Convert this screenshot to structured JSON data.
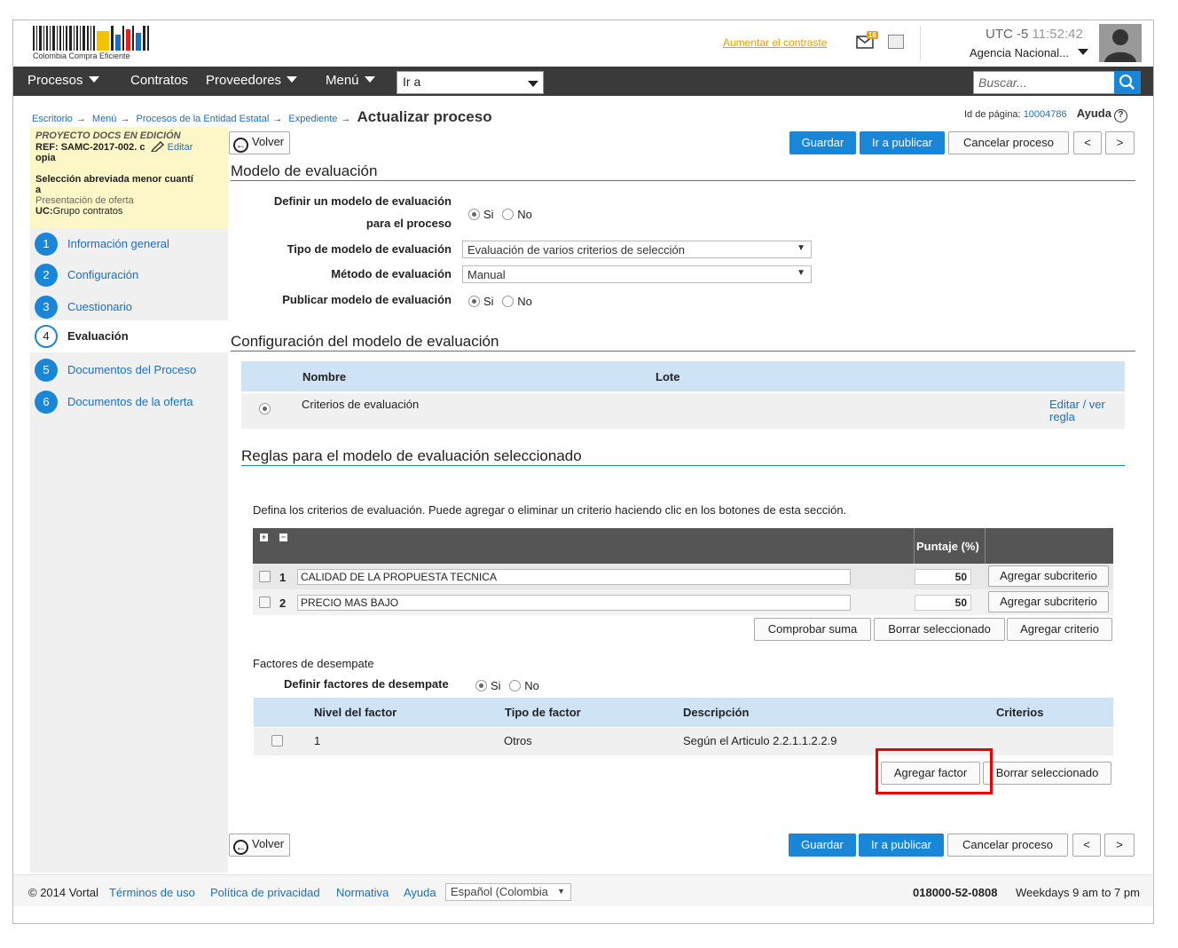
{
  "header": {
    "logo_text": "Colombia Compra Eficiente",
    "contrast_link": "Aumentar el contraste",
    "mail_badge": "16",
    "utc_label": "UTC -5",
    "time": "11:52:42",
    "agency": "Agencia Nacional..."
  },
  "nav": {
    "items": [
      "Procesos",
      "Contratos",
      "Proveedores",
      "Menú"
    ],
    "goto_label": "Ir a",
    "search_placeholder": "Buscar..."
  },
  "breadcrumb": {
    "items": [
      "Escritorio",
      "Menú",
      "Procesos de la Entidad Estatal",
      "Expediente"
    ],
    "current": "Actualizar proceso"
  },
  "page_info": {
    "page_id_label": "Id de página:",
    "page_id": "10004786",
    "help": "Ayuda"
  },
  "sidebar": {
    "status": "PROYECTO DOCS EN EDICIÓN",
    "ref": "REF: SAMC-2017-002. c",
    "ref_cont": "opia",
    "edit": "Editar",
    "modality": "Selección abreviada menor cuantí",
    "modality_cont": "a",
    "phase": "Presentación de oferta",
    "uc_label": "UC:",
    "uc_value": "Grupo contratos",
    "steps": [
      {
        "num": "1",
        "label": "Información general"
      },
      {
        "num": "2",
        "label": "Configuración"
      },
      {
        "num": "3",
        "label": "Cuestionario"
      },
      {
        "num": "4",
        "label": "Evaluación"
      },
      {
        "num": "5",
        "label": "Documentos del Proceso"
      },
      {
        "num": "6",
        "label": "Documentos de la oferta"
      }
    ]
  },
  "actions": {
    "back": "Volver",
    "save": "Guardar",
    "publish": "Ir a publicar",
    "cancel": "Cancelar proceso",
    "prev": "<",
    "next": ">"
  },
  "eval_model": {
    "title": "Modelo de evaluación",
    "define_label_1": "Definir un modelo de evaluación",
    "define_label_2": "para el proceso",
    "yes": "Si",
    "no": "No",
    "type_label": "Tipo de modelo de evaluación",
    "type_value": "Evaluación de varios criterios de selección",
    "method_label": "Método de evaluación",
    "method_value": "Manual",
    "publish_label": "Publicar modelo de evaluación"
  },
  "config": {
    "title": "Configuración del modelo de evaluación",
    "col_name": "Nombre",
    "col_lot": "Lote",
    "row_name": "Criterios de evaluación",
    "row_link_1": "Editar / ver",
    "row_link_2": "regla"
  },
  "rules": {
    "title": "Reglas para el modelo de evaluación seleccionado",
    "instructions": "Defina los criterios de evaluación. Puede agregar o eliminar un criterio haciendo clic en los botones de esta sección.",
    "score_header": "Puntaje (%)",
    "criteria": [
      {
        "num": "1",
        "name": "CALIDAD DE LA PROPUESTA TECNICA",
        "score": "50",
        "action": "Agregar subcriterio"
      },
      {
        "num": "2",
        "name": "PRECIO MAS BAJO",
        "score": "50",
        "action": "Agregar subcriterio"
      }
    ],
    "check_sum": "Comprobar suma",
    "delete_selected": "Borrar seleccionado",
    "add_criterion": "Agregar criterio"
  },
  "tiebreak": {
    "title": "Factores de desempate",
    "define_label": "Definir factores de desempate",
    "yes": "Si",
    "no": "No",
    "col_level": "Nivel del factor",
    "col_type": "Tipo de factor",
    "col_desc": "Descripción",
    "col_criteria": "Criterios",
    "rows": [
      {
        "level": "1",
        "type": "Otros",
        "desc": "Según el Articulo 2.2.1.1.2.2.9"
      }
    ],
    "add_factor": "Agregar factor",
    "delete_selected": "Borrar seleccionado"
  },
  "footer": {
    "copyright": "© 2014 Vortal",
    "links": [
      "Términos de uso",
      "Política de privacidad",
      "Normativa",
      "Ayuda"
    ],
    "language": "Español (Colombia",
    "phone": "018000-52-0808",
    "hours": "Weekdays 9 am to 7 pm"
  },
  "colors": {
    "accent": "#1a86d8",
    "highlight": "#e00000",
    "nav_bg": "#3a3a3a"
  }
}
